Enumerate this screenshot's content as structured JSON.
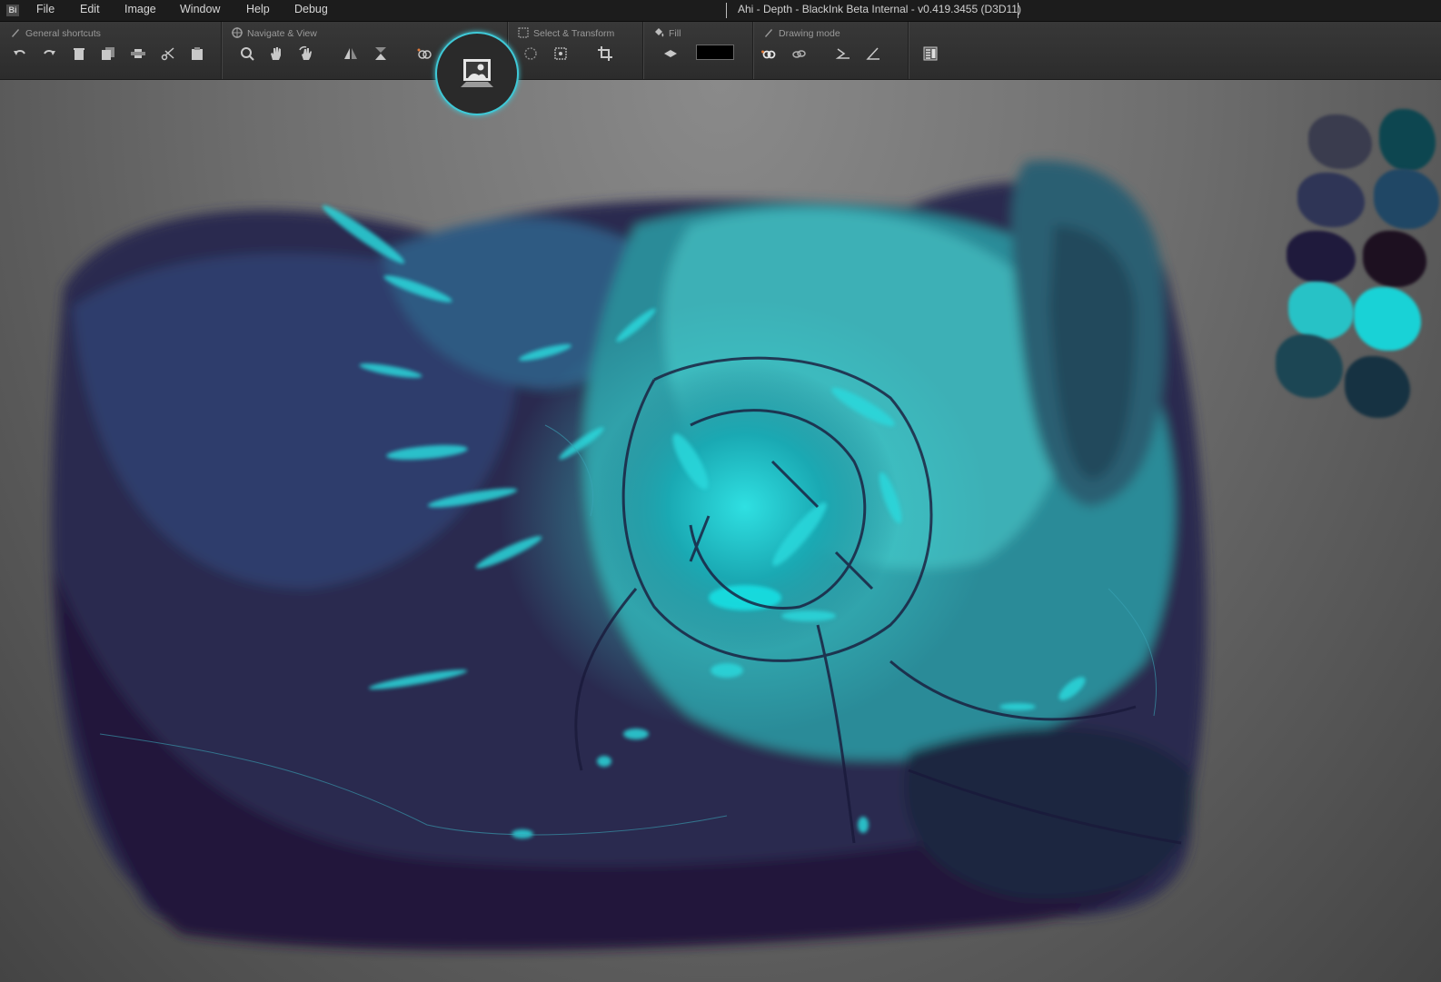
{
  "menubar": {
    "logo": "Bi",
    "items": [
      "File",
      "Edit",
      "Image",
      "Window",
      "Help",
      "Debug"
    ],
    "window_title": "Ahi - Depth - BlackInk Beta Internal - v0.419.3455 (D3D11)"
  },
  "toolbar": {
    "groups": {
      "general": "General shortcuts",
      "navigate": "Navigate & View",
      "select": "Select & Transform",
      "fill": "Fill",
      "drawing": "Drawing mode"
    }
  },
  "fill": {
    "color": "#000000"
  },
  "highlight": {
    "icon": "image-icon"
  },
  "palette": {
    "swatches": [
      "#3a3c4e",
      "#0d4650",
      "#2f3556",
      "#204765",
      "#1f1a3c",
      "#1d1020",
      "#27c2c6",
      "#19d2d6",
      "#1c4654",
      "#163242"
    ]
  },
  "colors": {
    "accent": "#3fc9d7",
    "menubar": "#1c1c1c",
    "toolbar": "#333333"
  }
}
